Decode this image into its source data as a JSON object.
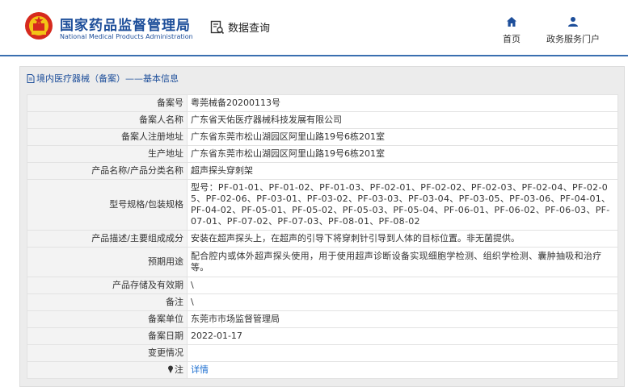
{
  "header": {
    "brand_cn": "国家药品监督管理局",
    "brand_en": "National Medical Products Administration",
    "query_label": "数据查询",
    "nav": {
      "home": "首页",
      "gov": "政务服务门户"
    },
    "colors": {
      "brand": "#1d4e9a",
      "link": "#1d6fd0"
    }
  },
  "breadcrumb": "境内医疗器械（备案）——基本信息",
  "rows": [
    {
      "key": "备案号",
      "value": "粤莞械备20200113号"
    },
    {
      "key": "备案人名称",
      "value": "广东省天佑医疗器械科技发展有限公司"
    },
    {
      "key": "备案人注册地址",
      "value": "广东省东莞市松山湖园区阿里山路19号6栋201室"
    },
    {
      "key": "生产地址",
      "value": "广东省东莞市松山湖园区阿里山路19号6栋201室"
    },
    {
      "key": "产品名称/产品分类名称",
      "value": "超声探头穿刺架"
    },
    {
      "key": "型号规格/包装规格",
      "value": "型号：PF-01-01、PF-01-02、PF-01-03、PF-02-01、PF-02-02、PF-02-03、PF-02-04、PF-02-05、PF-02-06、PF-03-01、PF-03-02、PF-03-03、PF-03-04、PF-03-05、PF-03-06、PF-04-01、PF-04-02、PF-05-01、PF-05-02、PF-05-03、PF-05-04、PF-06-01、PF-06-02、PF-06-03、PF-07-01、PF-07-02、PF-07-03、PF-08-01、PF-08-02"
    },
    {
      "key": "产品描述/主要组成成分",
      "value": "安装在超声探头上，在超声的引导下将穿刺针引导到人体的目标位置。非无菌提供。"
    },
    {
      "key": "预期用途",
      "value": "配合腔内或体外超声探头使用，用于使用超声诊断设备实现细胞学检测、组织学检测、囊肿抽吸和治疗等。"
    },
    {
      "key": "产品存储及有效期",
      "value": "\\"
    },
    {
      "key": "备注",
      "value": "\\"
    },
    {
      "key": "备案单位",
      "value": "东莞市市场监督管理局"
    },
    {
      "key": "备案日期",
      "value": "2022-01-17"
    },
    {
      "key": "变更情况",
      "value": ""
    },
    {
      "key": "注",
      "value": "详情"
    }
  ]
}
